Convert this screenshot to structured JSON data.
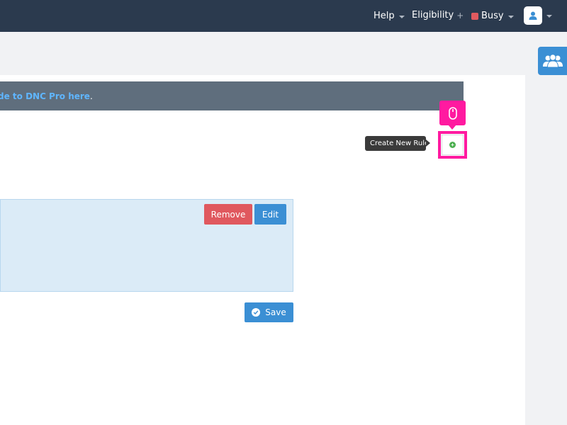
{
  "nav": {
    "help_label": "Help",
    "eligibility_label": "Eligibility",
    "eligibility_plus": "+",
    "busy_label": "Busy",
    "busy_color": "#e05a5f",
    "avatar_icon": "user-icon"
  },
  "banner": {
    "link_text": "de to DNC Pro here",
    "trailing": "."
  },
  "tooltip": {
    "text": "Create New Rule"
  },
  "create_button": {
    "icon": "plus-circle-icon",
    "icon_color": "#4caf50"
  },
  "rule": {
    "remove_label": "Remove",
    "edit_label": "Edit"
  },
  "save": {
    "label": "Save",
    "icon": "check-circle-icon"
  },
  "colors": {
    "topbar": "#2b3a4e",
    "highlight": "#ff1aa0",
    "primary": "#3b8fd4",
    "danger": "#e0585e",
    "banner": "#5f6e7d",
    "link": "#5fb6ff"
  },
  "side": {
    "icon": "team-icon"
  }
}
